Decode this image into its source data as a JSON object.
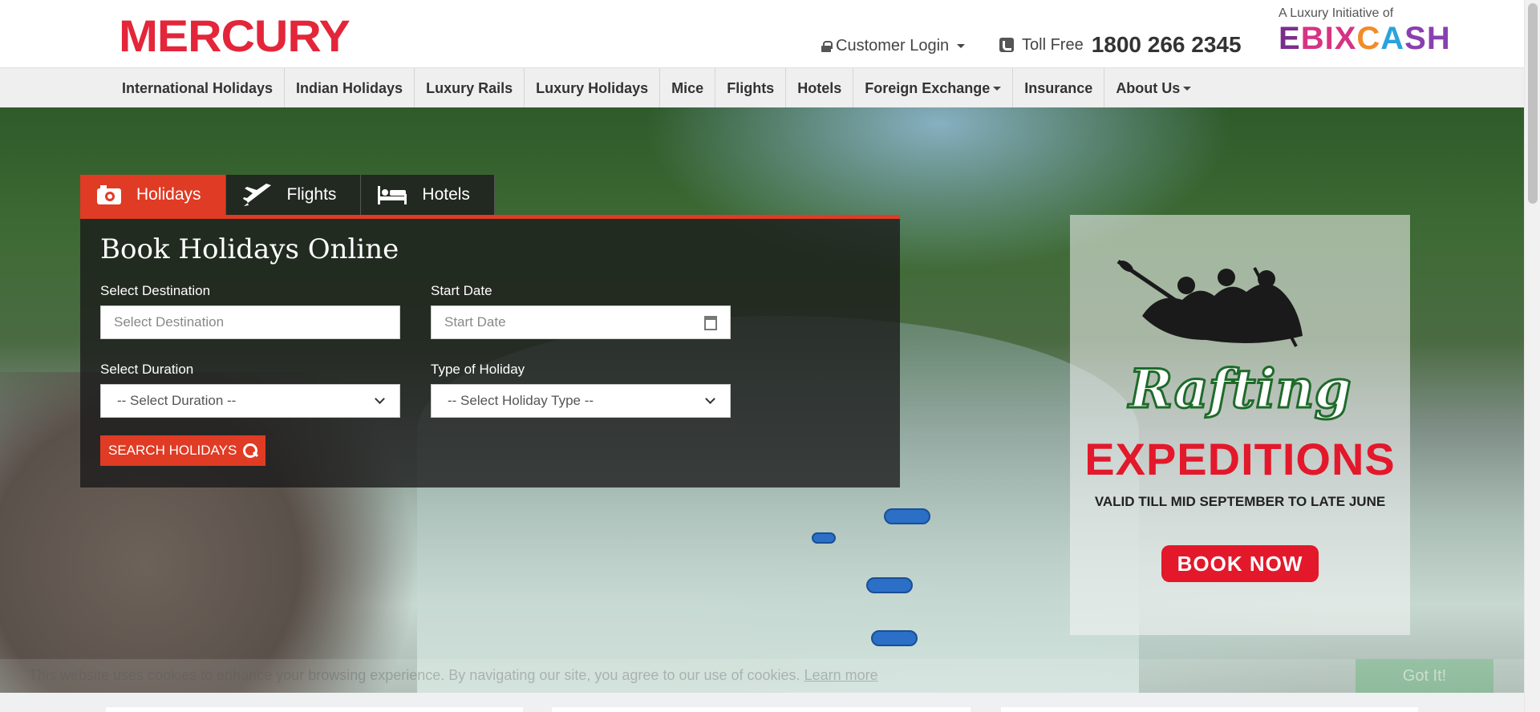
{
  "header": {
    "logo": "MERCURY",
    "login_label": "Customer Login",
    "toll_label": "Toll Free",
    "toll_number": "1800 266 2345",
    "ebix_tagline": "A Luxury Initiative of",
    "ebix_logo": [
      "E",
      "BIX",
      "C",
      "A",
      "SH"
    ]
  },
  "nav": {
    "items": [
      {
        "label": "International Holidays"
      },
      {
        "label": "Indian Holidays"
      },
      {
        "label": "Luxury Rails"
      },
      {
        "label": "Luxury Holidays"
      },
      {
        "label": "Mice"
      },
      {
        "label": "Flights"
      },
      {
        "label": "Hotels"
      },
      {
        "label": "Foreign Exchange"
      },
      {
        "label": "Insurance"
      },
      {
        "label": "About Us"
      }
    ]
  },
  "search": {
    "tabs": [
      {
        "label": "Holidays",
        "icon": "camera-icon"
      },
      {
        "label": "Flights",
        "icon": "plane-icon"
      },
      {
        "label": "Hotels",
        "icon": "bed-icon"
      }
    ],
    "title": "Book Holidays Online",
    "destination_label": "Select Destination",
    "destination_placeholder": "Select Destination",
    "start_date_label": "Start Date",
    "start_date_placeholder": "Start Date",
    "duration_label": "Select Duration",
    "duration_value": "-- Select Duration --",
    "holiday_type_label": "Type of Holiday",
    "holiday_type_value": "-- Select Holiday Type --",
    "button_label": "SEARCH HOLIDAYS"
  },
  "promo": {
    "title_script": "Rafting",
    "title_bold": "EXPEDITIONS",
    "validity": "VALID TILL MID SEPTEMBER TO LATE JUNE",
    "cta": "BOOK NOW"
  },
  "cookie": {
    "text": "This website uses cookies to enhance your browsing experience. By navigating our site, you agree to our use of cookies.",
    "link": "Learn more",
    "button": "Got It!"
  },
  "colors": {
    "brand_red": "#e3263a",
    "accent_orange_red": "#e03b24",
    "nav_bg": "#efefef"
  }
}
